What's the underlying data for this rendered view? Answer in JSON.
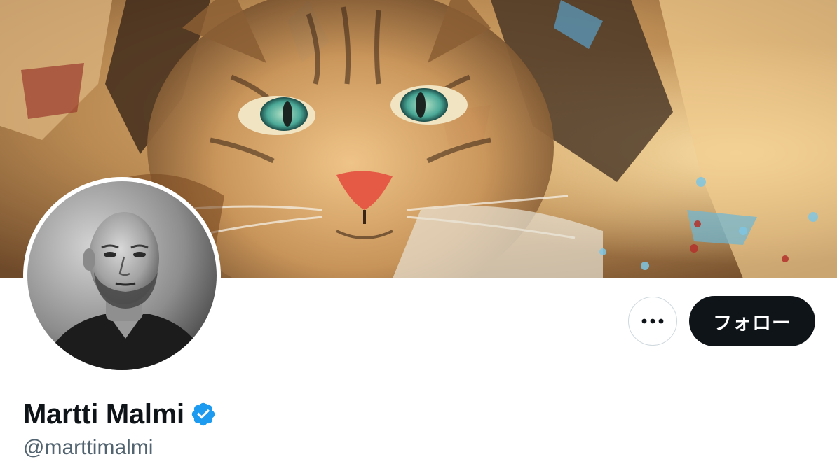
{
  "profile": {
    "display_name": "Martti Malmi",
    "handle": "@marttimalmi",
    "verified": true
  },
  "actions": {
    "more_label": "…",
    "follow_label": "フォロー"
  },
  "banner": {
    "description_icon": "painted-cat-banner"
  },
  "colors": {
    "follow_bg": "#0f1419",
    "verified": "#1d9bf0",
    "handle_text": "#536471",
    "border": "#cfd9de"
  }
}
